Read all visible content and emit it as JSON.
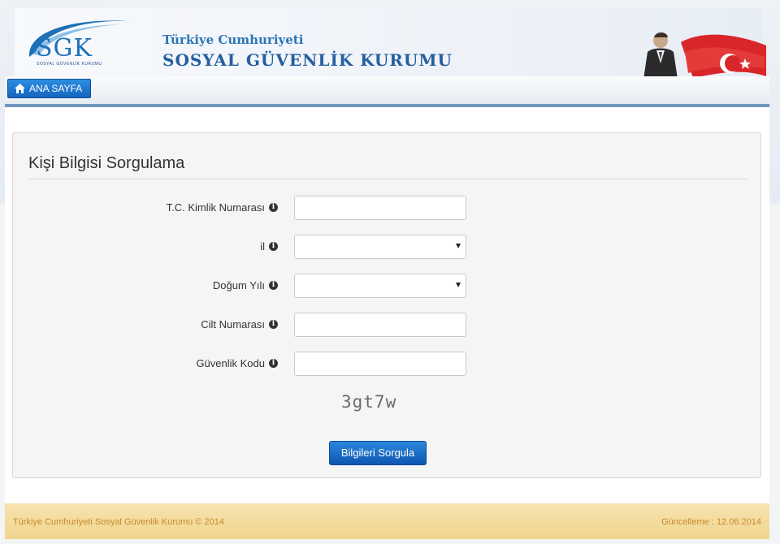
{
  "header": {
    "logo_text": "SGK",
    "logo_subtext": "SOSYAL GÜVENLİK KURUMU",
    "title_line1": "Türkiye Cumhuriyeti",
    "title_line2": "SOSYAL GÜVENLİK KURUMU"
  },
  "nav": {
    "home_label": "ANA SAYFA",
    "home_icon": "home-icon"
  },
  "form": {
    "title": "Kişi Bilgisi Sorgulama",
    "fields": [
      {
        "label": "T.C. Kimlik Numarası",
        "type": "text",
        "value": ""
      },
      {
        "label": "il",
        "type": "select",
        "value": ""
      },
      {
        "label": "Doğum Yılı",
        "type": "select",
        "value": ""
      },
      {
        "label": "Cilt Numarası",
        "type": "text",
        "value": ""
      },
      {
        "label": "Güvenlik Kodu",
        "type": "text",
        "value": ""
      }
    ],
    "info_icon": "i",
    "captcha": "3gt7w",
    "submit_label": "Bilgileri Sorgula"
  },
  "footer": {
    "left": "Türkiye Cumhuriyeti Sosyal Güvenlik Kurumu © 2014",
    "right": "Güncelleme : 12.06.2014"
  },
  "colors": {
    "accent": "#1565bf",
    "nav_border": "#6f97c2",
    "footer_bg": "#f0d58e"
  }
}
